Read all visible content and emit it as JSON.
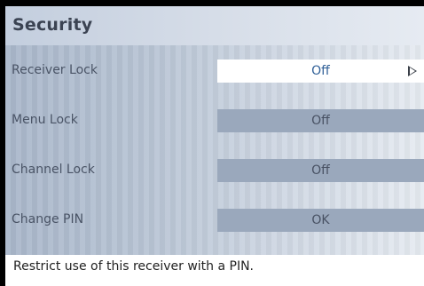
{
  "title": "Security",
  "rows": [
    {
      "label": "Receiver Lock",
      "value": "Off",
      "selected": true
    },
    {
      "label": "Menu Lock",
      "value": "Off",
      "selected": false
    },
    {
      "label": "Channel Lock",
      "value": "Off",
      "selected": false
    },
    {
      "label": "Change PIN",
      "value": "OK",
      "selected": false
    }
  ],
  "help_text": "Restrict use of this receiver with a PIN.",
  "icons": {
    "selected_arrow": "right-arrow-icon"
  },
  "colors": {
    "selected_value_bg": "#ffffff",
    "selected_value_text": "#2f5f97",
    "value_bg": "#9aa8bc",
    "title_text": "#3b4352"
  }
}
